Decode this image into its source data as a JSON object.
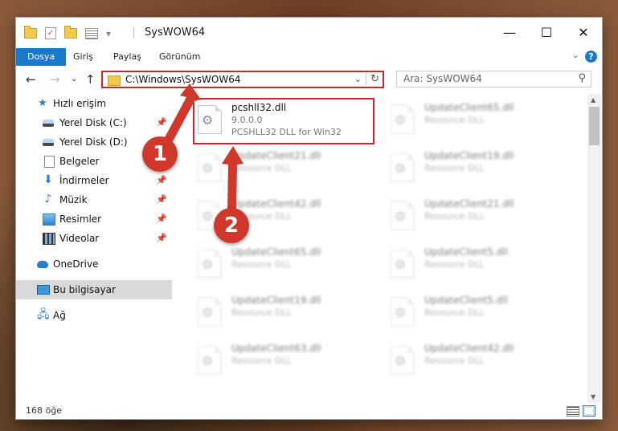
{
  "window": {
    "title": "SysWOW64",
    "controls": {
      "minimize": "—",
      "maximize": "☐",
      "close": "✕"
    }
  },
  "ribbon": {
    "tabs": [
      "Dosya",
      "Giriş",
      "Paylaş",
      "Görünüm"
    ],
    "help": "?"
  },
  "address": {
    "path": "C:\\Windows\\SysWOW64",
    "search_placeholder": "Ara: SysWOW64"
  },
  "nav": {
    "items": [
      {
        "label": "Hızlı erişim",
        "icon": "star-icon"
      },
      {
        "label": "Yerel Disk (C:)",
        "icon": "disk-icon",
        "pinned": true
      },
      {
        "label": "Yerel Disk (D:)",
        "icon": "disk-icon",
        "pinned": true
      },
      {
        "label": "Belgeler",
        "icon": "document-icon",
        "pinned": true
      },
      {
        "label": "İndirmeler",
        "icon": "download-icon",
        "pinned": true
      },
      {
        "label": "Müzik",
        "icon": "music-icon",
        "pinned": true
      },
      {
        "label": "Resimler",
        "icon": "pictures-icon",
        "pinned": true
      },
      {
        "label": "Videolar",
        "icon": "video-icon",
        "pinned": true
      },
      {
        "label": "OneDrive",
        "icon": "onedrive-icon"
      },
      {
        "label": "Bu bilgisayar",
        "icon": "computer-icon",
        "selected": true
      },
      {
        "label": "Ağ",
        "icon": "network-icon"
      }
    ]
  },
  "files": [
    {
      "name": "pcshll32.dll",
      "line2": "9.0.0.0",
      "line3": "PCSHLL32 DLL for Win32"
    },
    {
      "name": "UpdateClient65.dll",
      "line2": "Resource DLL"
    },
    {
      "name": "UpdateClient21.dll",
      "line2": "Resource DLL"
    },
    {
      "name": "UpdateClient19.dll",
      "line2": "Resource DLL"
    },
    {
      "name": "UpdateClient42.dll",
      "line2": "Resource DLL"
    },
    {
      "name": "UpdateClient21.dll",
      "line2": "Resource DLL"
    },
    {
      "name": "UpdateClient65.dll",
      "line2": "Resource DLL"
    },
    {
      "name": "UpdateClient5.dll",
      "line2": "Resource DLL"
    },
    {
      "name": "UpdateClient19.dll",
      "line2": "Resource DLL"
    },
    {
      "name": "UpdateClient5.dll",
      "line2": "Resource DLL"
    },
    {
      "name": "UpdateClient63.dll",
      "line2": "Resource DLL"
    },
    {
      "name": "UpdateClient42.dll",
      "line2": "Resource DLL"
    }
  ],
  "status": {
    "item_count": "168 öğe"
  },
  "annotations": {
    "step1": "1",
    "step2": "2"
  },
  "colors": {
    "accent": "#1979ca",
    "highlight_red": "#d8202a",
    "badge_red": "#d0382b"
  }
}
